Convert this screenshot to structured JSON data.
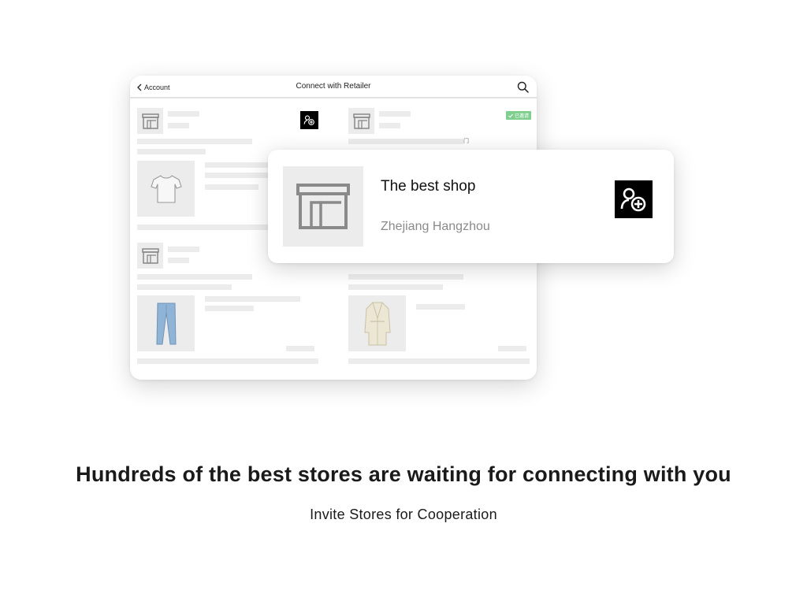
{
  "device": {
    "back_label": "Account",
    "title": "Connect with Retailer",
    "invited_badge": "已邀请",
    "store_suffix_glyph": "门",
    "icons": {
      "back": "chevron-left-icon",
      "search": "search-icon",
      "follow": "add-user-icon",
      "store": "store-icon"
    }
  },
  "shop_card": {
    "name": "The best shop",
    "location": "Zhejiang Hangzhou",
    "thumb_icon": "store-icon",
    "follow_icon": "add-user-icon"
  },
  "colors": {
    "accent_black": "#000000",
    "invited_green": "#7fcf8f",
    "placeholder_gray": "#ececec",
    "location_gray": "#8a8a8a"
  },
  "headline": "Hundreds of the best stores are waiting for connecting with you",
  "subline": "Invite Stores for Cooperation"
}
